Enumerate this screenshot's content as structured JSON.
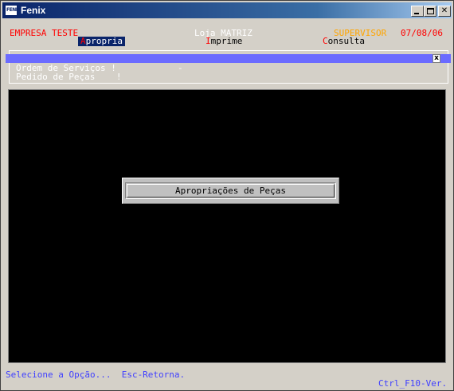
{
  "window": {
    "title": "Fenix",
    "icon_text": "FENIX"
  },
  "header": {
    "company": "EMPRESA TESTE",
    "store": "Loja MATRIZ",
    "user": "SUPERVISOR",
    "date": "07/08/06"
  },
  "menu": {
    "items": [
      {
        "hotkey": "A",
        "rest": "propria",
        "selected": true
      },
      {
        "hotkey": "I",
        "rest": "mprime",
        "selected": false
      },
      {
        "hotkey": "C",
        "rest": "onsulta",
        "selected": false
      }
    ]
  },
  "submenu": {
    "close_glyph": "x",
    "line1": "Ordem de Serviços !",
    "line1_suffix": "-",
    "line2": "Pedido de Peças    !"
  },
  "dialog": {
    "label": "Apropriações de Peças"
  },
  "status": {
    "hint": "Selecione a Opção...  Esc-Retorna.",
    "version": "Ctrl_F10-Ver."
  },
  "colors": {
    "company": "#ff0000",
    "user": "#ffa500",
    "date": "#ff0000",
    "hotkey": "#ff0000",
    "status": "#4040ff",
    "menu_bar": "#6b6bff"
  },
  "icons": {
    "minimize": "minimize-icon",
    "maximize": "maximize-icon",
    "close": "close-icon"
  }
}
